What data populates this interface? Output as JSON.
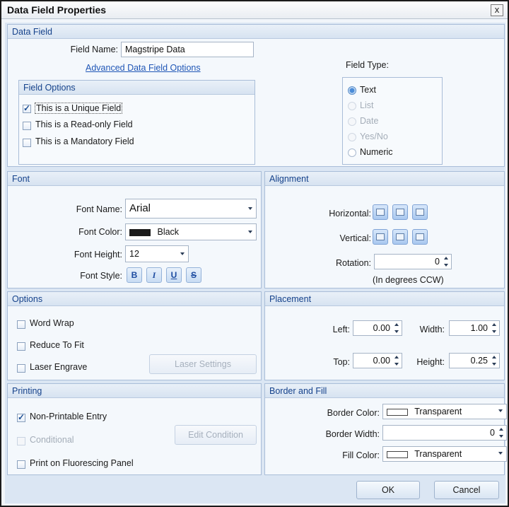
{
  "window": {
    "title": "Data Field Properties",
    "close": "x"
  },
  "data_field": {
    "header": "Data Field",
    "field_name_label": "Field Name:",
    "field_name_value": "Magstripe Data",
    "advanced_link": "Advanced Data Field Options",
    "field_options_header": "Field Options",
    "options": [
      {
        "label": "This is a Unique Field",
        "checked": true
      },
      {
        "label": "This is a Read-only Field",
        "checked": false
      },
      {
        "label": "This is a Mandatory Field",
        "checked": false
      }
    ],
    "field_type_label": "Field Type:",
    "field_types": [
      {
        "label": "Text",
        "selected": true,
        "enabled": true
      },
      {
        "label": "List",
        "selected": false,
        "enabled": false
      },
      {
        "label": "Date",
        "selected": false,
        "enabled": false
      },
      {
        "label": "Yes/No",
        "selected": false,
        "enabled": false
      },
      {
        "label": "Numeric",
        "selected": false,
        "enabled": true
      }
    ]
  },
  "font": {
    "header": "Font",
    "name_label": "Font Name:",
    "name_value": "Arial",
    "color_label": "Font Color:",
    "color_value": "Black",
    "color_hex": "#1a1a1a",
    "height_label": "Font Height:",
    "height_value": "12",
    "style_label": "Font Style:",
    "style_buttons": [
      "B",
      "I",
      "U",
      "S"
    ]
  },
  "alignment": {
    "header": "Alignment",
    "horizontal_label": "Horizontal:",
    "vertical_label": "Vertical:",
    "rotation_label": "Rotation:",
    "rotation_value": "0",
    "rotation_note": "(In degrees CCW)"
  },
  "options": {
    "header": "Options",
    "word_wrap": "Word Wrap",
    "reduce_to_fit": "Reduce To Fit",
    "laser_engrave": "Laser Engrave",
    "laser_settings": "Laser Settings"
  },
  "placement": {
    "header": "Placement",
    "left_label": "Left:",
    "left_value": "0.00",
    "width_label": "Width:",
    "width_value": "1.00",
    "top_label": "Top:",
    "top_value": "0.00",
    "height_label": "Height:",
    "height_value": "0.25"
  },
  "printing": {
    "header": "Printing",
    "non_printable": "Non-Printable Entry",
    "conditional": "Conditional",
    "edit_condition": "Edit Condition",
    "fluorescing": "Print on Fluorescing Panel"
  },
  "border_fill": {
    "header": "Border and Fill",
    "border_color_label": "Border Color:",
    "border_color_value": "Transparent",
    "border_width_label": "Border Width:",
    "border_width_value": "0",
    "fill_color_label": "Fill Color:",
    "fill_color_value": "Transparent"
  },
  "footer": {
    "ok": "OK",
    "cancel": "Cancel"
  }
}
